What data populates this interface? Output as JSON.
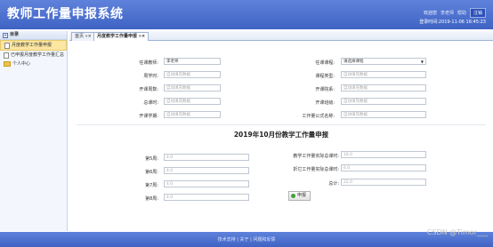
{
  "header": {
    "title": "教师工作量申报系统",
    "welcome": "欢迎您",
    "user": "李老师",
    "help": "帮助",
    "logout": "注销",
    "login_time": "登录时间:2019-11-06 16:45:23"
  },
  "sidebar": {
    "title": "目录",
    "items": [
      {
        "label": "月度教学工作量申报"
      },
      {
        "label": "已申报月度教学工作量汇总"
      },
      {
        "label": "个人中心"
      }
    ]
  },
  "tabs": [
    {
      "label": "首页",
      "close": "»×"
    },
    {
      "label": "月度教学工作量申报",
      "close": "»×"
    }
  ],
  "form": {
    "teacher_label": "任课教师:",
    "teacher_value": "李老师",
    "course_label": "任课课程:",
    "course_value": "请选择课程",
    "weekly_hours_label": "周学时:",
    "weekly_hours_placeholder": "自动填充数据",
    "course_type_label": "课程类型:",
    "course_type_placeholder": "自动填充数据",
    "weeks_label": "开课周数:",
    "weeks_placeholder": "自动填充数据",
    "dept_label": "开课院系:",
    "dept_placeholder": "自动填充数据",
    "total_hours_label": "总课时:",
    "total_hours_placeholder": "自动填充数据",
    "class_label": "开课班级:",
    "class_placeholder": "自动填充数据",
    "semester_label": "开课学期:",
    "semester_placeholder": "自动填充数据",
    "formula_label": "工作量公式名称:",
    "formula_placeholder": "自动填充数据"
  },
  "report": {
    "title": "2019年10月份教学工作量申报",
    "weeks": [
      {
        "label": "第5周:",
        "value": "4.0"
      },
      {
        "label": "第6周:",
        "value": "4.0"
      },
      {
        "label": "第7周:",
        "value": "4.0"
      },
      {
        "label": "第8周:",
        "value": "4.0"
      }
    ],
    "actual_hours_label": "教学工作量实际总课时:",
    "actual_hours_value": "16.0",
    "converted_label": "折它工作量实际总课时:",
    "converted_value": "6.0",
    "total_label": "总计:",
    "total_value": "22.0",
    "submit_label": "申报"
  },
  "footer": {
    "text": "技术支持 | 关于 | 问题和反馈"
  },
  "watermark": "CSDN @Timor___"
}
